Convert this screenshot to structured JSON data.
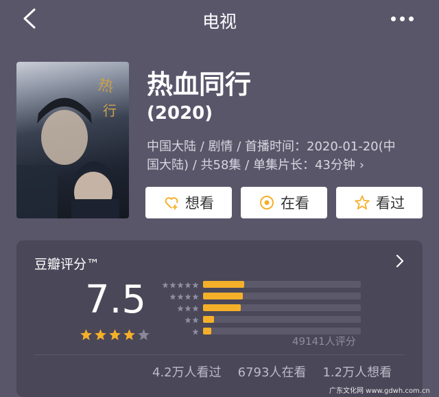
{
  "topbar": {
    "title": "电视"
  },
  "movie": {
    "title": "热血同行",
    "year": "(2020)",
    "meta_line1": "中国大陆 / 剧情 / 首播时间：2020-01-20(中",
    "meta_line2": "国大陆) / 共58集 / 单集片长：43分钟"
  },
  "actions": {
    "want": "想看",
    "watching": "在看",
    "watched": "看过"
  },
  "rating": {
    "label": "豆瓣评分™",
    "score": "7.5",
    "stars_filled": 4,
    "stars_total": 5,
    "distribution": [
      0.26,
      0.25,
      0.24,
      0.07,
      0.05
    ],
    "count": "49141人评分",
    "watched_count": "4.2万人看过",
    "watching_count": "6793人在看",
    "want_count": "1.2万人想看"
  },
  "colors": {
    "accent": "#f5b02a",
    "background": "#5a566a",
    "card": "#4a4758"
  },
  "icons": {
    "back": "chevron-left-icon",
    "more": "more-dots-icon"
  },
  "watermark": "广东文化网 www.gdwh.com.cn"
}
